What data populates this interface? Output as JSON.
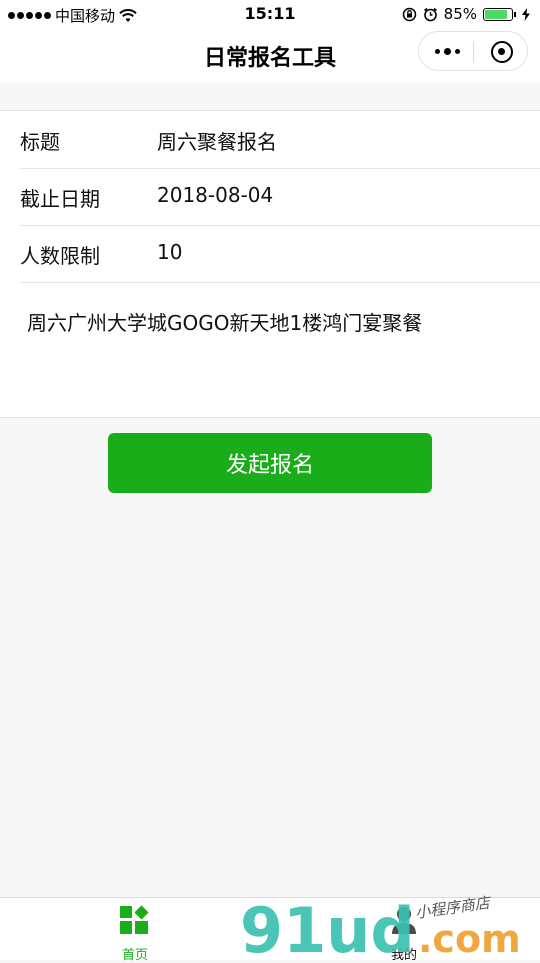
{
  "status_bar": {
    "carrier": "中国移动",
    "time": "15:11",
    "battery_percent": "85%",
    "battery_level": 0.85
  },
  "nav": {
    "title": "日常报名工具"
  },
  "form": {
    "title_label": "标题",
    "title_value": "周六聚餐报名",
    "deadline_label": "截止日期",
    "deadline_value": "2018-08-04",
    "limit_label": "人数限制",
    "limit_value": "10",
    "description": "周六广州大学城GOGO新天地1楼鸿门宴聚餐"
  },
  "actions": {
    "submit_label": "发起报名"
  },
  "tab_bar": {
    "home_label": "首页",
    "mine_label": "我的"
  },
  "watermark": {
    "brand": "91ud",
    "suffix": ".com",
    "tagline": "小程序商店"
  },
  "colors": {
    "accent": "#1aad19",
    "background": "#f7f7f7"
  }
}
